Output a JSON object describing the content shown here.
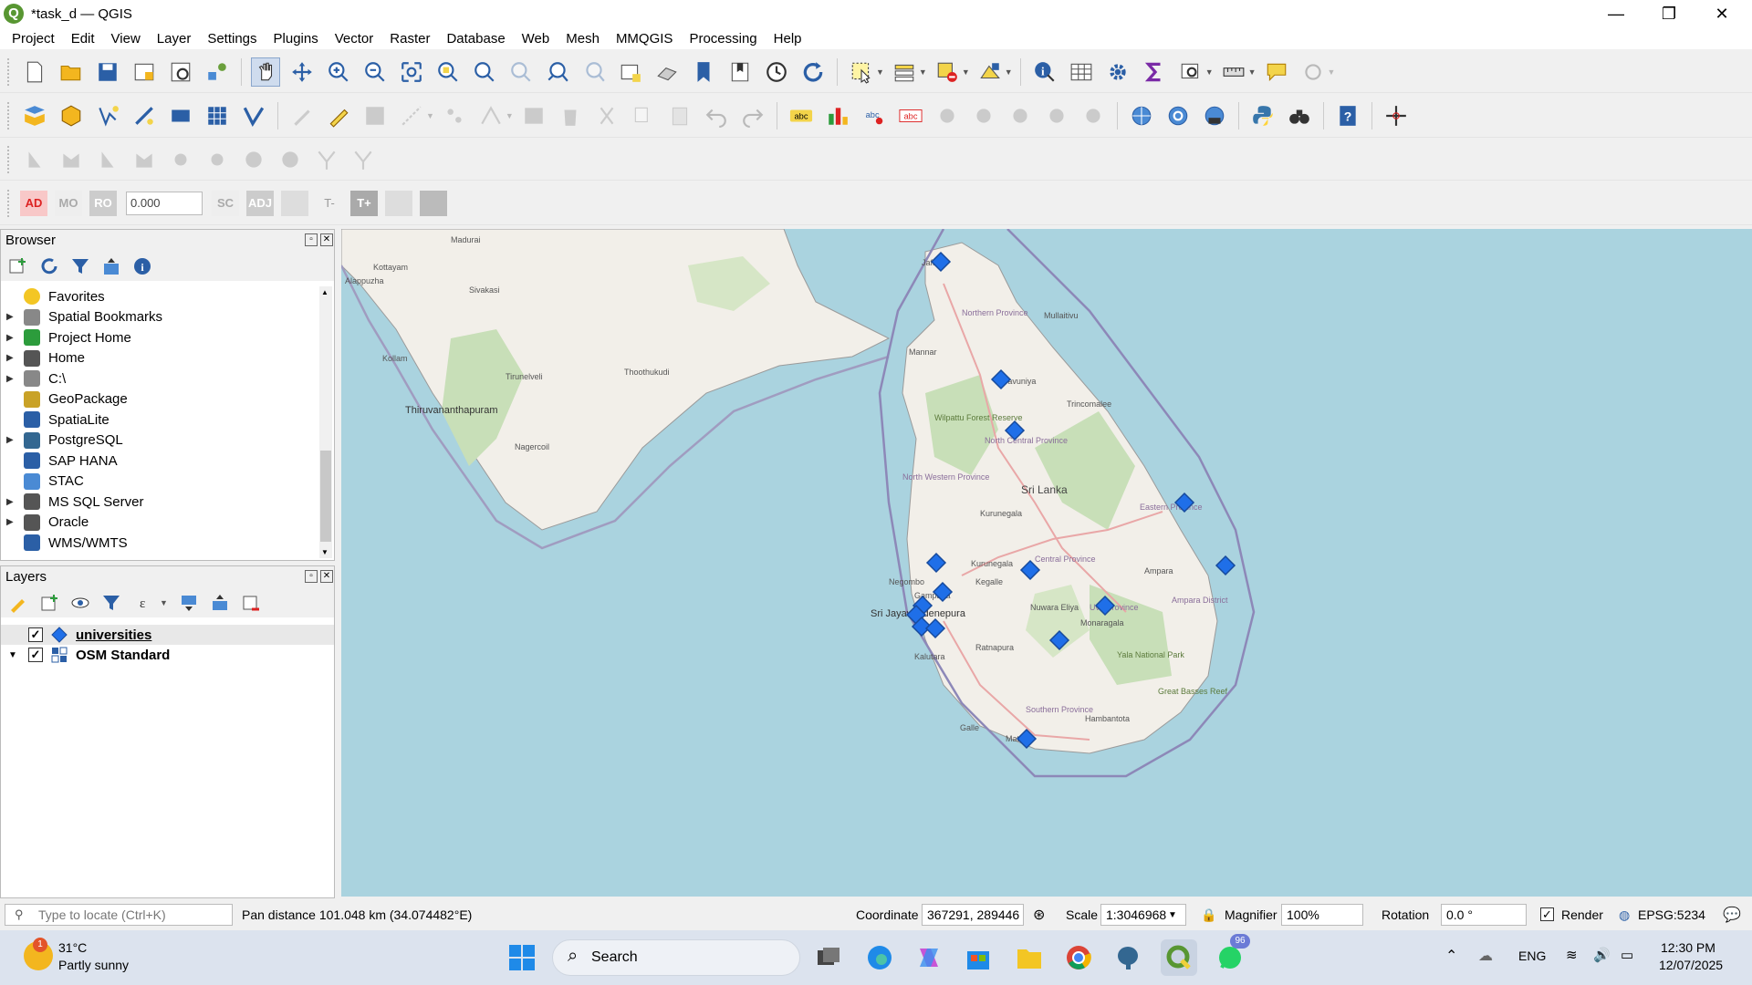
{
  "window": {
    "title": "*task_d — QGIS",
    "minimize": "—",
    "restore": "❐",
    "close": "✕"
  },
  "menu": [
    "Project",
    "Edit",
    "View",
    "Layer",
    "Settings",
    "Plugins",
    "Vector",
    "Raster",
    "Database",
    "Web",
    "Mesh",
    "MMQGIS",
    "Processing",
    "Help"
  ],
  "adv_toolbar": {
    "ad": "AD",
    "mo": "MO",
    "ro": "RO",
    "value": "0.000",
    "sc": "SC",
    "adj": "ADJ",
    "t_minus": "T-",
    "t_plus": "T+"
  },
  "browser": {
    "title": "Browser",
    "items": [
      {
        "label": "Favorites",
        "icon": "star-icon",
        "expandable": false
      },
      {
        "label": "Spatial Bookmarks",
        "icon": "bookmark-icon",
        "expandable": true
      },
      {
        "label": "Project Home",
        "icon": "project-home-icon",
        "expandable": true
      },
      {
        "label": "Home",
        "icon": "home-icon",
        "expandable": true
      },
      {
        "label": "C:\\",
        "icon": "drive-icon",
        "expandable": true
      },
      {
        "label": "GeoPackage",
        "icon": "geopackage-icon",
        "expandable": false
      },
      {
        "label": "SpatiaLite",
        "icon": "spatialite-icon",
        "expandable": false
      },
      {
        "label": "PostgreSQL",
        "icon": "postgresql-icon",
        "expandable": true
      },
      {
        "label": "SAP HANA",
        "icon": "sap-hana-icon",
        "expandable": false
      },
      {
        "label": "STAC",
        "icon": "stac-icon",
        "expandable": false
      },
      {
        "label": "MS SQL Server",
        "icon": "mssql-icon",
        "expandable": true
      },
      {
        "label": "Oracle",
        "icon": "oracle-icon",
        "expandable": true
      },
      {
        "label": "WMS/WMTS",
        "icon": "wms-icon",
        "expandable": false
      }
    ]
  },
  "layers": {
    "title": "Layers",
    "items": [
      {
        "label": "universities",
        "checked": true,
        "icon": "point-layer-icon"
      },
      {
        "label": "OSM Standard",
        "checked": true,
        "icon": "raster-layer-icon"
      }
    ]
  },
  "map": {
    "labels": {
      "jaffna": "Jaffna",
      "northern": "Northern Province",
      "mullaitivu": "Mullaitivu",
      "mannar": "Mannar",
      "vavuniya": "Vavuniya",
      "trincomalee": "Trincomalee",
      "nc_province": "North Central Province",
      "nw_province": "North Western Province",
      "srilanka": "Sri Lanka",
      "eastern": "Eastern Province",
      "kurunegala": "Kurunegala",
      "central": "Central Province",
      "negombo": "Negombo",
      "kegalle": "Kegalle",
      "ampara": "Ampara",
      "gampaha": "Gampaha",
      "uva": "Uva Province",
      "colombo": "Sri Jayawardenepura",
      "nuwara": "Nuwara Eliya",
      "monaragala": "Monaragala",
      "ratnapura": "Ratnapura",
      "kalutara": "Kalutara",
      "yala": "Yala National Park",
      "southern": "Southern Province",
      "hambantota": "Hambantota",
      "galle": "Galle",
      "matara": "Matara",
      "thiruvananthapuram": "Thiruvananthapuram",
      "kollam": "Kollam",
      "thoothukudi": "Thoothukudi",
      "tirunelveli": "Tirunelveli",
      "kottayam": "Kottayam",
      "alappuzha": "Alappuzha",
      "sivakasi": "Sivakasi",
      "nagercoil": "Nagercoil",
      "madurai": "Madurai",
      "wilpattu": "Wilpattu Forest Reserve",
      "great_basses": "Great Basses Reef",
      "ampara_district": "Ampara District"
    },
    "point_color": "#1f6fe8"
  },
  "status": {
    "locate_placeholder": "Type to locate (Ctrl+K)",
    "message": "Pan distance 101.048 km (34.074482°E)",
    "coordinate_label": "Coordinate",
    "coordinate": "367291, 289446",
    "scale_label": "Scale",
    "scale": "1:3046968",
    "magnifier_label": "Magnifier",
    "magnifier": "100%",
    "rotation_label": "Rotation",
    "rotation": "0.0 °",
    "render_label": "Render",
    "crs": "EPSG:5234"
  },
  "taskbar": {
    "temp": "31°C",
    "weather": "Partly sunny",
    "weather_badge": "1",
    "search": "Search",
    "lang": "ENG",
    "time": "12:30 PM",
    "date": "12/07/2025",
    "whatsapp_badge": "96"
  }
}
